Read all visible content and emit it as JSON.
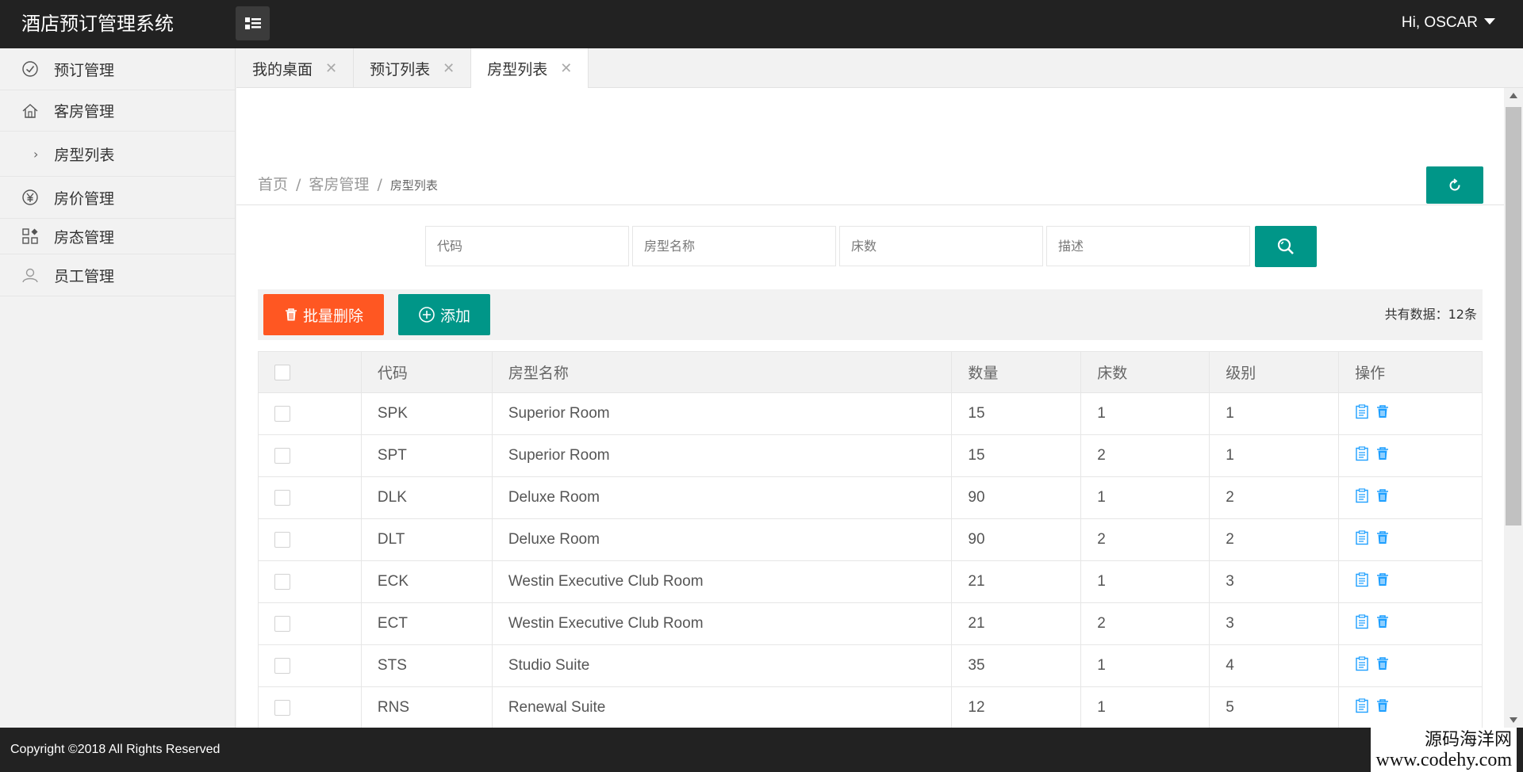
{
  "app": {
    "title": "酒店预订管理系统",
    "user_greeting": "Hi, OSCAR"
  },
  "sidebar": {
    "items": [
      {
        "label": "预订管理",
        "icon": "check-circle-icon"
      },
      {
        "label": "客房管理",
        "icon": "home-icon"
      },
      {
        "label": "房型列表",
        "icon": "chevron-right-icon",
        "sub": true
      },
      {
        "label": "房价管理",
        "icon": "yen-icon"
      },
      {
        "label": "房态管理",
        "icon": "apps-icon"
      },
      {
        "label": "员工管理",
        "icon": "user-icon"
      }
    ]
  },
  "tabs": [
    {
      "label": "我的桌面",
      "active": false
    },
    {
      "label": "预订列表",
      "active": false
    },
    {
      "label": "房型列表",
      "active": true
    }
  ],
  "breadcrumb": {
    "home": "首页",
    "section": "客房管理",
    "current": "房型列表",
    "separator": "/"
  },
  "search": {
    "code_placeholder": "代码",
    "name_placeholder": "房型名称",
    "beds_placeholder": "床数",
    "desc_placeholder": "描述"
  },
  "toolbar": {
    "batch_delete_label": "批量删除",
    "add_label": "添加",
    "total_text": "共有数据：12条"
  },
  "table": {
    "headers": [
      "代码",
      "房型名称",
      "数量",
      "床数",
      "级别",
      "操作"
    ],
    "rows": [
      {
        "code": "SPK",
        "name": "Superior Room",
        "qty": "15",
        "beds": "1",
        "level": "1"
      },
      {
        "code": "SPT",
        "name": "Superior Room",
        "qty": "15",
        "beds": "2",
        "level": "1"
      },
      {
        "code": "DLK",
        "name": "Deluxe Room",
        "qty": "90",
        "beds": "1",
        "level": "2"
      },
      {
        "code": "DLT",
        "name": "Deluxe Room",
        "qty": "90",
        "beds": "2",
        "level": "2"
      },
      {
        "code": "ECK",
        "name": "Westin Executive Club Room",
        "qty": "21",
        "beds": "1",
        "level": "3"
      },
      {
        "code": "ECT",
        "name": "Westin Executive Club Room",
        "qty": "21",
        "beds": "2",
        "level": "3"
      },
      {
        "code": "STS",
        "name": "Studio Suite",
        "qty": "35",
        "beds": "1",
        "level": "4"
      },
      {
        "code": "RNS",
        "name": "Renewal Suite",
        "qty": "12",
        "beds": "1",
        "level": "5"
      }
    ]
  },
  "footer": {
    "copyright": "Copyright ©2018 All Rights Reserved",
    "watermark_line1": "源码海洋网",
    "watermark_line2": "www.codehy.com"
  },
  "colors": {
    "header_bg": "#222222",
    "primary": "#009688",
    "danger": "#ff5722",
    "icon_blue": "#1e9fff"
  }
}
